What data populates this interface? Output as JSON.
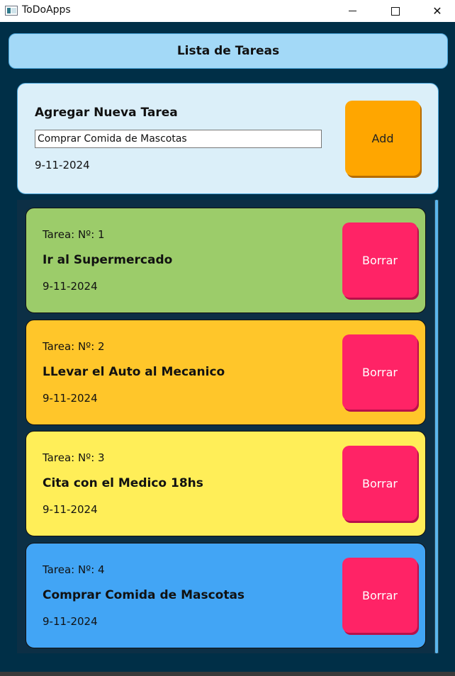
{
  "window": {
    "title": "ToDoApps",
    "controls": {
      "minimize": "minimize",
      "maximize": "maximize",
      "close": "close"
    }
  },
  "header": {
    "title": "Lista de Tareas"
  },
  "add_panel": {
    "heading": "Agregar Nueva Tarea",
    "input_value": "Comprar Comida de Mascotas",
    "date": "9-11-2024",
    "add_label": "Add"
  },
  "tasks": [
    {
      "number": "Tarea: Nº: 1",
      "title": "Ir al Supermercado",
      "date": "9-11-2024",
      "delete_label": "Borrar"
    },
    {
      "number": "Tarea: Nº: 2",
      "title": "LLevar el Auto al Mecanico",
      "date": "9-11-2024",
      "delete_label": "Borrar"
    },
    {
      "number": "Tarea: Nº: 3",
      "title": "Cita con el Medico 18hs",
      "date": "9-11-2024",
      "delete_label": "Borrar"
    },
    {
      "number": "Tarea: Nº: 4",
      "title": "Comprar Comida de Mascotas",
      "date": "9-11-2024",
      "delete_label": "Borrar"
    }
  ],
  "colors": {
    "window_bg": "#002f47",
    "header_bg": "#a3d9f7",
    "add_card_bg": "#dbeff9",
    "add_button": "#ffa600",
    "delete_button": "#ff2366",
    "task_colors": [
      "#9ccc6a",
      "#ffc62a",
      "#ffee58",
      "#42a5f5"
    ]
  },
  "icons": {
    "app": "app-window-icon",
    "minimize": "minimize-icon",
    "maximize": "maximize-icon",
    "close": "close-icon"
  }
}
